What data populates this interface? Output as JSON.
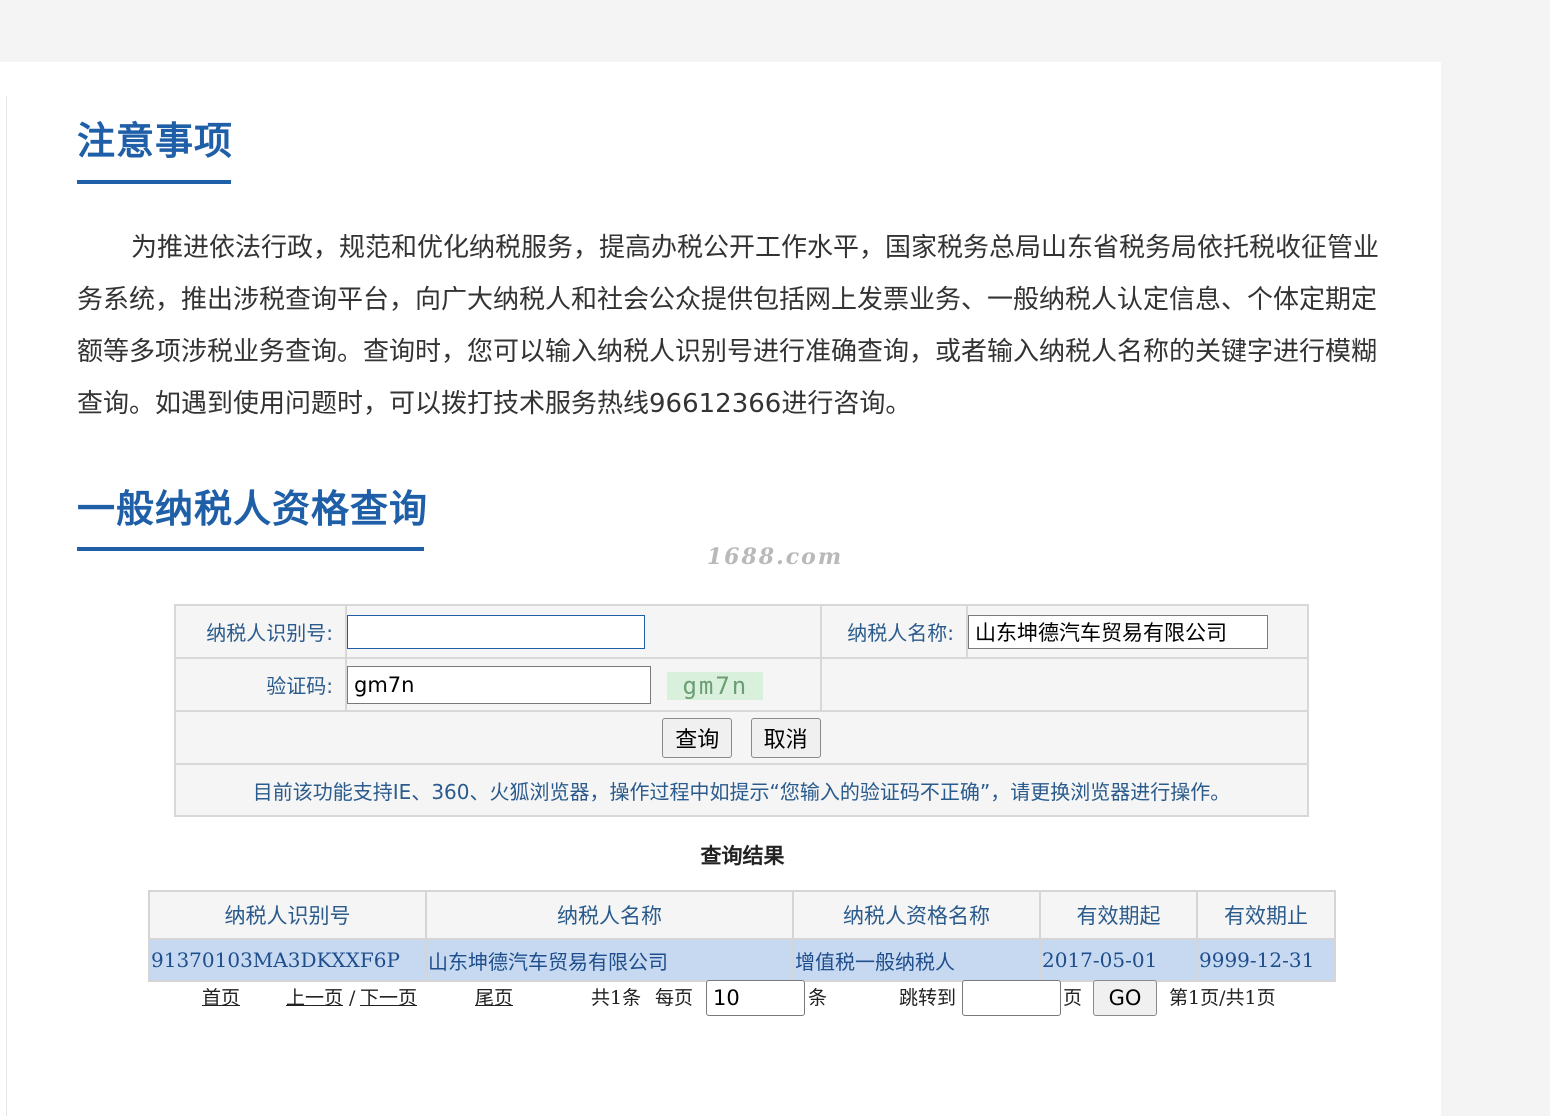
{
  "notice": {
    "title": "注意事项",
    "body": "为推进依法行政，规范和优化纳税服务，提高办税公开工作水平，国家税务总局山东省税务局依托税收征管业务系统，推出涉税查询平台，向广大纳税人和社会公众提供包括网上发票业务、一般纳税人认定信息、个体定期定额等多项涉税业务查询。查询时，您可以输入纳税人识别号进行准确查询，或者输入纳税人名称的关键字进行模糊查询。如遇到使用问题时，可以拨打技术服务热线96612366进行咨询。"
  },
  "query": {
    "title": "一般纳税人资格查询",
    "watermark": "1688.com",
    "form": {
      "taxpayer_id_label": "纳税人识别号:",
      "taxpayer_id_value": "",
      "taxpayer_name_label": "纳税人名称:",
      "taxpayer_name_value": "山东坤德汽车贸易有限公司",
      "captcha_label": "验证码:",
      "captcha_value": "gm7n",
      "captcha_image_text": "gm7n",
      "submit_label": "查询",
      "cancel_label": "取消",
      "hint": "目前该功能支持IE、360、火狐浏览器，操作过程中如提示“您输入的验证码不正确”，请更换浏览器进行操作。"
    }
  },
  "results": {
    "title": "查询结果",
    "columns": [
      "纳税人识别号",
      "纳税人名称",
      "纳税人资格名称",
      "有效期起",
      "有效期止"
    ],
    "rows": [
      [
        "91370103MA3DKXXF6P",
        "山东坤德汽车贸易有限公司",
        "增值税一般纳税人",
        "2017-05-01",
        "9999-12-31"
      ]
    ]
  },
  "pager": {
    "first": "首页",
    "prev": "上一页",
    "separator": "/",
    "next": "下一页",
    "last": "尾页",
    "total_text": "共1条",
    "per_page_label": "每页",
    "per_page_value": "10",
    "per_page_unit": "条",
    "jump_label": "跳转到",
    "jump_value": "",
    "page_unit": "页",
    "go_label": "GO",
    "page_status": "第1页/共1页"
  },
  "colors": {
    "heading": "#1f5fa8",
    "label": "#2a5b8c",
    "row_highlight": "#c6d9f1"
  }
}
